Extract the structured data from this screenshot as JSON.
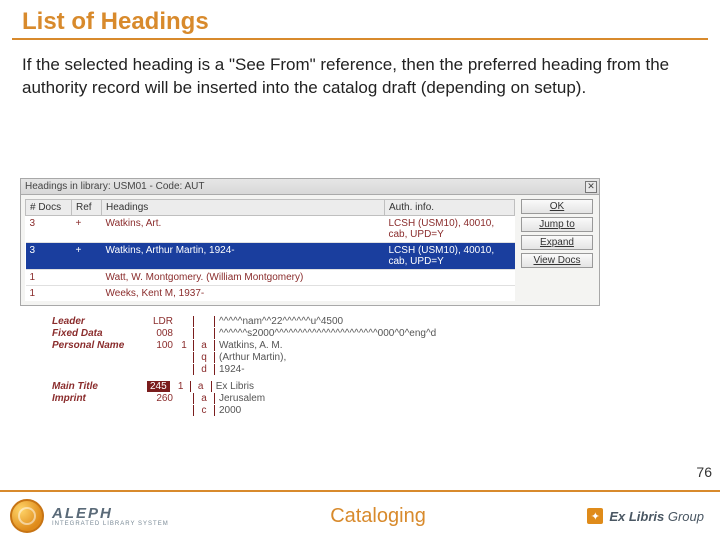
{
  "slide": {
    "title": "List of Headings",
    "body": "If the selected heading is a \"See From\" reference, then the preferred heading from the authority record will be inserted into the catalog draft (depending on setup).",
    "page_number": "76"
  },
  "window": {
    "title": "Headings in library: USM01 - Code: AUT",
    "columns": {
      "docs": "# Docs",
      "ref": "Ref",
      "headings": "Headings",
      "auth": "Auth. info."
    },
    "rows": [
      {
        "docs": "3",
        "ref": "+",
        "heading": "Watkins, Art.",
        "auth": "LCSH (USM10), 40010, cab, UPD=Y",
        "selected": false
      },
      {
        "docs": "3",
        "ref": "+",
        "heading": "Watkins, Arthur Martin, 1924-",
        "auth": "LCSH (USM10), 40010, cab, UPD=Y",
        "selected": true
      },
      {
        "docs": "1",
        "ref": "",
        "heading": "Watt, W. Montgomery. (William Montgomery)",
        "auth": "",
        "selected": false
      },
      {
        "docs": "1",
        "ref": "",
        "heading": "Weeks, Kent M, 1937-",
        "auth": "",
        "selected": false
      }
    ],
    "buttons": {
      "ok": "OK",
      "jump": "Jump to",
      "expand": "Expand",
      "view": "View Docs"
    }
  },
  "record": {
    "fields": [
      {
        "label": "Leader",
        "tag": "LDR",
        "ind": "",
        "sub": "",
        "value": "^^^^^nam^^22^^^^^^u^4500"
      },
      {
        "label": "Fixed Data",
        "tag": "008",
        "ind": "",
        "sub": "",
        "value": "^^^^^^s2000^^^^^^^^^^^^^^^^^^^^^^000^0^eng^d"
      },
      {
        "label": "Personal Name",
        "tag": "100",
        "ind": "1",
        "sub": "a",
        "value": "Watkins, A. M."
      },
      {
        "label": "",
        "tag": "",
        "ind": "",
        "sub": "q",
        "value": "(Arthur Martin),"
      },
      {
        "label": "",
        "tag": "",
        "ind": "",
        "sub": "d",
        "value": "1924-"
      },
      {
        "label": "Main Title",
        "tag": "245",
        "ind": "1",
        "sub": "a",
        "value": "Ex Libris",
        "hl": true
      },
      {
        "label": "Imprint",
        "tag": "260",
        "ind": "",
        "sub": "a",
        "value": "Jerusalem"
      },
      {
        "label": "",
        "tag": "",
        "ind": "",
        "sub": "c",
        "value": "2000"
      }
    ]
  },
  "footer": {
    "aleph_brand": "ALEPH",
    "aleph_tag": "INTEGRATED LIBRARY SYSTEM",
    "center": "Cataloging",
    "exlibris_a": "Ex Libris",
    "exlibris_b": " Group"
  }
}
